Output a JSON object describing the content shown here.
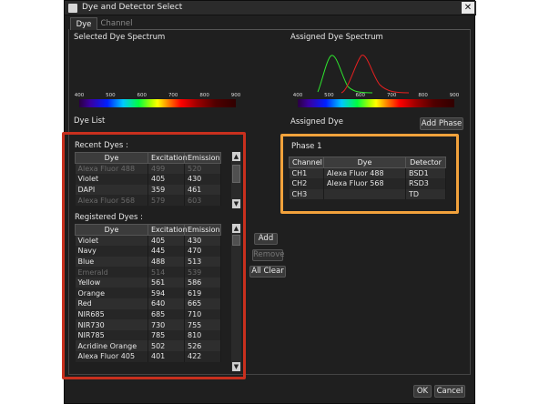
{
  "window": {
    "title": "Dye and Detector Select",
    "close_symbol": "✕"
  },
  "tabs": [
    {
      "label": "Dye",
      "active": true
    },
    {
      "label": "Channel",
      "active": false
    }
  ],
  "selected_spectrum": {
    "label": "Selected Dye Spectrum",
    "ticks": [
      "400",
      "500",
      "600",
      "700",
      "800",
      "900"
    ]
  },
  "assigned_spectrum": {
    "label": "Assigned Dye Spectrum",
    "ticks": [
      "400",
      "500",
      "600",
      "700",
      "800",
      "900"
    ]
  },
  "dye_list": {
    "label": "Dye List",
    "recent": {
      "label": "Recent Dyes :",
      "columns": [
        "Dye",
        "Excitation",
        "Emission"
      ],
      "rows": [
        [
          "Alexa Fluor 488",
          "499",
          "520"
        ],
        [
          "Violet",
          "405",
          "430"
        ],
        [
          "DAPI",
          "359",
          "461"
        ],
        [
          "Alexa Fluor 568",
          "579",
          "603"
        ]
      ]
    },
    "registered": {
      "label": "Registered Dyes :",
      "columns": [
        "Dye",
        "Excitation",
        "Emission"
      ],
      "rows": [
        [
          "Violet",
          "405",
          "430"
        ],
        [
          "Navy",
          "445",
          "470"
        ],
        [
          "Blue",
          "488",
          "513"
        ],
        [
          "Emerald",
          "514",
          "539"
        ],
        [
          "Yellow",
          "561",
          "586"
        ],
        [
          "Orange",
          "594",
          "619"
        ],
        [
          "Red",
          "640",
          "665"
        ],
        [
          "NIR685",
          "685",
          "710"
        ],
        [
          "NIR730",
          "730",
          "755"
        ],
        [
          "NIR785",
          "785",
          "810"
        ],
        [
          "Acridine Orange",
          "502",
          "526"
        ],
        [
          "Alexa Fluor 405",
          "401",
          "422"
        ]
      ]
    }
  },
  "actions": {
    "add": "Add",
    "remove": "Remove",
    "all_clear": "All Clear"
  },
  "assigned": {
    "label": "Assigned Dye",
    "add_phase": "Add Phase",
    "phase_label": "Phase 1",
    "columns": [
      "Channel",
      "Dye",
      "Detector"
    ],
    "rows": [
      [
        "CH1",
        "Alexa Fluor 488",
        "BSD1"
      ],
      [
        "CH2",
        "Alexa Fluor 568",
        "RSD3"
      ],
      [
        "CH3",
        "",
        "TD"
      ]
    ]
  },
  "footer": {
    "ok": "OK",
    "cancel": "Cancel"
  },
  "colors": {
    "highlight_red": "#c8301e",
    "highlight_orange": "#f2a23c",
    "curve_green": "#2ee82e",
    "curve_red": "#e82020"
  }
}
